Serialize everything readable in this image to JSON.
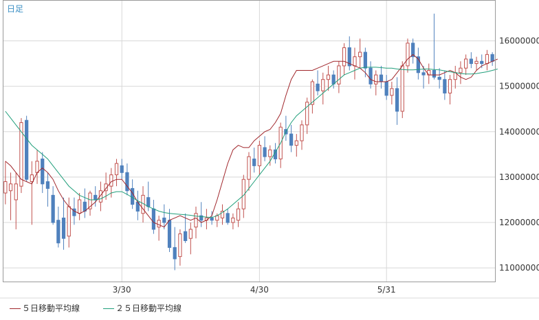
{
  "timeframe_label": "日足",
  "colors": {
    "up": "#c0504d",
    "down": "#4f81bd",
    "ma5": "#a0262b",
    "ma25": "#1f9e7a",
    "grid": "#d8d8d8",
    "axis": "#999999"
  },
  "chart_data": {
    "type": "candlestick",
    "title": "",
    "xlabel": "",
    "ylabel": "",
    "ylim": [
      10700000,
      16900000
    ],
    "yticks": [
      11000000,
      12000000,
      13000000,
      14000000,
      15000000,
      16000000
    ],
    "ytick_labels": [
      "11000000",
      "12000000",
      "13000000",
      "14000000",
      "15000000",
      "16000000"
    ],
    "xticks": [
      {
        "index": 22,
        "label": "3/30"
      },
      {
        "index": 48,
        "label": "4/30"
      },
      {
        "index": 72,
        "label": "5/31"
      }
    ],
    "grid": true,
    "legend_position": "bottom-left",
    "series": [
      {
        "name": "５日移動平均線",
        "color": "#a0262b",
        "values": [
          13350000,
          13250000,
          13100000,
          12950000,
          12900000,
          12850000,
          13100000,
          13200000,
          13100000,
          12950000,
          12700000,
          12500000,
          12350000,
          12250000,
          12200000,
          12250000,
          12350000,
          12450000,
          12600000,
          12750000,
          12900000,
          12950000,
          12950000,
          12800000,
          12650000,
          12450000,
          12300000,
          12150000,
          12000000,
          11950000,
          11900000,
          12050000,
          12100000,
          12150000,
          12100000,
          12050000,
          12100000,
          12000000,
          12050000,
          12150000,
          12500000,
          12900000,
          13300000,
          13600000,
          13700000,
          13650000,
          13650000,
          13800000,
          13900000,
          14000000,
          14050000,
          14200000,
          14400000,
          14800000,
          15150000,
          15350000,
          15350000,
          15350000,
          15350000,
          15400000,
          15450000,
          15500000,
          15550000,
          15550000,
          15550000,
          15500000,
          15450000,
          15400000,
          15300000,
          15150000,
          15100000,
          15100000,
          15100000,
          15150000,
          15300000,
          15450000,
          15600000,
          15700000,
          15600000,
          15400000,
          15250000,
          15250000,
          15250000,
          15300000,
          15350000,
          15300000,
          15200000,
          15150000,
          15200000,
          15350000,
          15450000,
          15500000,
          15550000,
          15600000
        ]
      },
      {
        "name": "２５日移動平均線",
        "color": "#1f9e7a",
        "values": [
          14450000,
          14300000,
          14150000,
          14000000,
          13850000,
          13700000,
          13600000,
          13500000,
          13400000,
          13250000,
          13100000,
          12950000,
          12800000,
          12700000,
          12600000,
          12550000,
          12500000,
          12500000,
          12520000,
          12580000,
          12650000,
          12680000,
          12680000,
          12620000,
          12550000,
          12480000,
          12420000,
          12350000,
          12300000,
          12250000,
          12220000,
          12200000,
          12190000,
          12180000,
          12170000,
          12160000,
          12140000,
          12130000,
          12120000,
          12110000,
          12150000,
          12220000,
          12300000,
          12400000,
          12500000,
          12600000,
          12750000,
          12900000,
          13050000,
          13200000,
          13350000,
          13550000,
          13750000,
          14000000,
          14200000,
          14350000,
          14450000,
          14550000,
          14650000,
          14750000,
          14850000,
          14950000,
          15050000,
          15150000,
          15250000,
          15300000,
          15350000,
          15400000,
          15420000,
          15420000,
          15420000,
          15410000,
          15400000,
          15400000,
          15380000,
          15370000,
          15360000,
          15360000,
          15370000,
          15380000,
          15380000,
          15370000,
          15360000,
          15340000,
          15320000,
          15300000,
          15280000,
          15270000,
          15270000,
          15280000,
          15300000,
          15320000,
          15350000,
          15380000
        ]
      }
    ],
    "candles": [
      [
        12650000,
        13350000,
        12400000,
        12900000
      ],
      [
        12700000,
        13100000,
        12050000,
        12850000
      ],
      [
        12500000,
        13100000,
        11850000,
        12850000
      ],
      [
        12800000,
        14300000,
        12650000,
        14200000
      ],
      [
        14250000,
        14350000,
        12900000,
        12950000
      ],
      [
        12900000,
        13350000,
        11950000,
        13050000
      ],
      [
        13100000,
        13600000,
        12850000,
        13350000
      ],
      [
        13400000,
        13550000,
        12650000,
        12850000
      ],
      [
        12900000,
        13100000,
        12350000,
        12750000
      ],
      [
        12600000,
        12800000,
        11950000,
        12000000
      ],
      [
        12050000,
        12350000,
        11450000,
        11550000
      ],
      [
        12100000,
        12550000,
        11400000,
        11650000
      ],
      [
        11700000,
        12550000,
        11450000,
        12350000
      ],
      [
        12300000,
        12550000,
        11950000,
        12150000
      ],
      [
        12200000,
        12650000,
        12050000,
        12500000
      ],
      [
        12450000,
        12750000,
        12100000,
        12250000
      ],
      [
        12300000,
        12700000,
        12150000,
        12650000
      ],
      [
        12600000,
        12800000,
        12350000,
        12500000
      ],
      [
        12450000,
        12900000,
        12250000,
        12700000
      ],
      [
        12700000,
        13100000,
        12500000,
        12850000
      ],
      [
        12800000,
        13200000,
        12550000,
        13050000
      ],
      [
        13050000,
        13400000,
        12800000,
        13300000
      ],
      [
        13250000,
        13400000,
        12950000,
        13100000
      ],
      [
        13100000,
        13300000,
        12600000,
        12700000
      ],
      [
        12750000,
        12950000,
        12300000,
        12400000
      ],
      [
        12450000,
        12700000,
        12050000,
        12250000
      ],
      [
        12200000,
        12800000,
        12000000,
        12600000
      ],
      [
        12550000,
        12900000,
        12250000,
        12350000
      ],
      [
        12300000,
        12500000,
        11750000,
        11850000
      ],
      [
        11900000,
        12150000,
        11600000,
        12050000
      ],
      [
        12100000,
        12400000,
        11850000,
        12000000
      ],
      [
        12050000,
        12300000,
        11350000,
        11450000
      ],
      [
        11450000,
        11900000,
        10950000,
        11200000
      ],
      [
        11250000,
        11850000,
        11050000,
        11750000
      ],
      [
        11800000,
        12200000,
        11550000,
        11600000
      ],
      [
        11650000,
        12000000,
        11300000,
        11850000
      ],
      [
        11900000,
        12350000,
        11650000,
        12200000
      ],
      [
        12150000,
        12450000,
        11900000,
        12050000
      ],
      [
        12050000,
        12300000,
        11850000,
        12100000
      ],
      [
        12100000,
        12250000,
        11950000,
        12050000
      ],
      [
        12050000,
        12200000,
        11900000,
        12150000
      ],
      [
        12100000,
        12400000,
        11950000,
        12250000
      ],
      [
        12200000,
        12300000,
        11950000,
        12000000
      ],
      [
        12000000,
        12200000,
        11850000,
        12100000
      ],
      [
        12050000,
        12450000,
        11900000,
        12300000
      ],
      [
        12300000,
        13050000,
        12100000,
        12950000
      ],
      [
        12950000,
        13550000,
        12700000,
        13450000
      ],
      [
        13400000,
        13650000,
        13100000,
        13250000
      ],
      [
        13250000,
        13800000,
        13050000,
        13700000
      ],
      [
        13650000,
        13900000,
        13350000,
        13450000
      ],
      [
        13450000,
        13700000,
        13250000,
        13600000
      ],
      [
        13600000,
        13750000,
        13300000,
        13400000
      ],
      [
        13400000,
        14200000,
        13200000,
        14100000
      ],
      [
        14050000,
        14350000,
        13800000,
        13950000
      ],
      [
        13950000,
        14150000,
        13550000,
        13700000
      ],
      [
        13700000,
        13950000,
        13450000,
        13800000
      ],
      [
        13800000,
        14250000,
        13600000,
        14150000
      ],
      [
        14150000,
        14750000,
        13950000,
        14650000
      ],
      [
        14600000,
        15150000,
        14400000,
        15100000
      ],
      [
        15050000,
        15350000,
        14800000,
        14900000
      ],
      [
        14900000,
        15300000,
        14600000,
        15150000
      ],
      [
        15150000,
        15450000,
        14900000,
        15250000
      ],
      [
        15250000,
        15350000,
        14950000,
        15050000
      ],
      [
        15050000,
        15550000,
        14850000,
        15450000
      ],
      [
        15450000,
        15950000,
        15250000,
        15850000
      ],
      [
        15850000,
        16100000,
        15350000,
        15450000
      ],
      [
        15450000,
        15850000,
        15150000,
        15650000
      ],
      [
        15650000,
        16050000,
        15400000,
        15750000
      ],
      [
        15750000,
        15850000,
        15200000,
        15400000
      ],
      [
        15400000,
        15550000,
        14950000,
        15050000
      ],
      [
        15050000,
        15350000,
        14800000,
        15250000
      ],
      [
        15250000,
        15450000,
        14950000,
        15100000
      ],
      [
        15100000,
        15250000,
        14700000,
        14800000
      ],
      [
        14800000,
        15100000,
        14600000,
        14950000
      ],
      [
        14950000,
        15200000,
        14150000,
        14450000
      ],
      [
        14450000,
        15550000,
        14300000,
        15450000
      ],
      [
        15450000,
        16050000,
        15300000,
        15950000
      ],
      [
        15950000,
        16050000,
        15500000,
        15650000
      ],
      [
        15650000,
        15850000,
        15150000,
        15300000
      ],
      [
        15300000,
        15450000,
        14950000,
        15250000
      ],
      [
        15250000,
        15500000,
        15050000,
        15350000
      ],
      [
        15350000,
        16600000,
        15150000,
        15200000
      ],
      [
        15200000,
        15400000,
        14950000,
        15150000
      ],
      [
        15150000,
        15350000,
        14700000,
        14850000
      ],
      [
        14850000,
        15250000,
        14600000,
        15150000
      ],
      [
        15150000,
        15450000,
        14950000,
        15300000
      ],
      [
        15300000,
        15550000,
        15050000,
        15400000
      ],
      [
        15400000,
        15700000,
        15250000,
        15600000
      ],
      [
        15600000,
        15750000,
        15400000,
        15500000
      ],
      [
        15500000,
        15650000,
        15350000,
        15550000
      ],
      [
        15550000,
        15700000,
        15400000,
        15500000
      ],
      [
        15500000,
        15800000,
        15350000,
        15700000
      ],
      [
        15700000,
        15750000,
        15450000,
        15550000
      ]
    ]
  }
}
